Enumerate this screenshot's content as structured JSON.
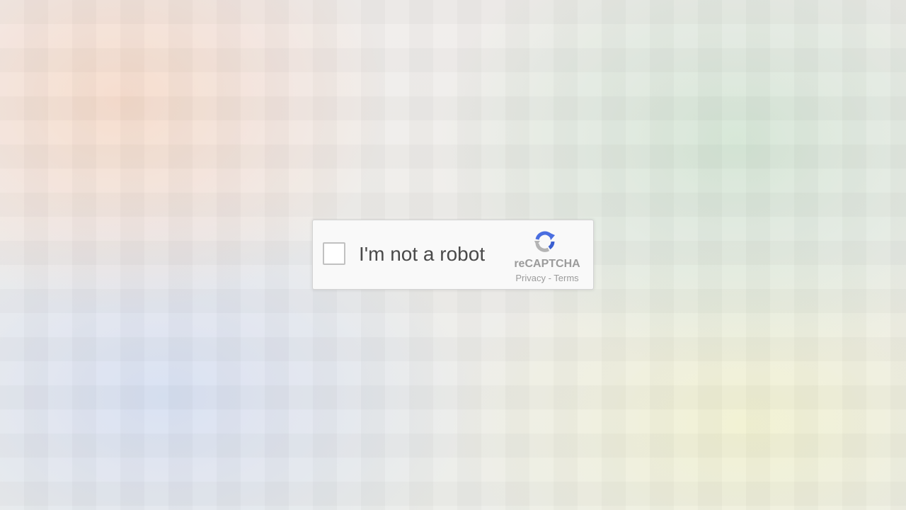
{
  "recaptcha": {
    "checkbox_label": "I'm not a robot",
    "brand": "reCAPTCHA",
    "privacy_link": "Privacy",
    "separator": " - ",
    "terms_link": "Terms",
    "logo_icon": "recaptcha-logo-icon"
  },
  "colors": {
    "logo_blue": "#4a6ee0",
    "logo_gray": "#b4b4b4",
    "text": "#4a4a4a",
    "muted": "#9b9b9b"
  }
}
